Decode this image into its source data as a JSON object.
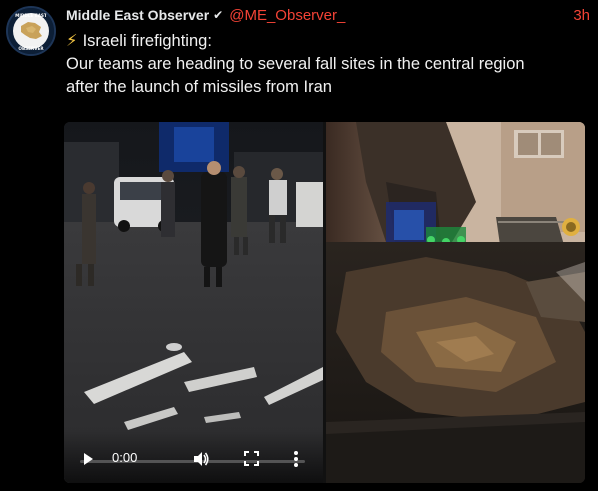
{
  "author": {
    "name": "Middle East Observer",
    "verified_mark": "✔",
    "handle": "@ME_Observer_",
    "time": "3h",
    "avatar_text": "MIDDLE EAST OBSERVER"
  },
  "post": {
    "emoji": "⚡",
    "lines": [
      "Israeli firefighting:",
      "Our teams are heading to several fall sites in the central region",
      "after the launch of missiles from Iran"
    ]
  },
  "video": {
    "timecode": "0:00",
    "progress": 0,
    "controls": [
      "play-icon",
      "volume-icon",
      "fullscreen-icon",
      "more-options-icon"
    ]
  },
  "colors": {
    "background": "#000000",
    "handle": "#f44336",
    "text": "#e7e9ea"
  }
}
